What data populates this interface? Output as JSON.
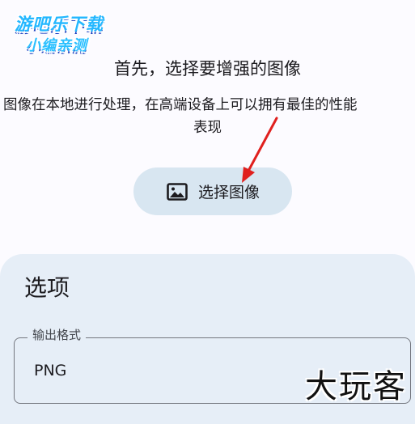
{
  "watermarks": {
    "top_line1": "游吧乐下载",
    "top_line2": "小编亲测",
    "bottom": "大玩客"
  },
  "header": {
    "headline": "首先，选择要增强的图像",
    "description_line1": "图像在本地进行处理，在高端设备上可以拥有最佳的性能",
    "description_line2": "表现"
  },
  "select_button": {
    "label": "选择图像",
    "icon": "image-icon"
  },
  "options": {
    "title": "选项",
    "output_format": {
      "label": "输出格式",
      "value": "PNG"
    }
  },
  "colors": {
    "background": "#fcfbff",
    "button_bg": "#d8e6f1",
    "card_bg": "#e6eef7",
    "arrow": "#e0201e",
    "watermark_blue": "#23b7ff"
  }
}
